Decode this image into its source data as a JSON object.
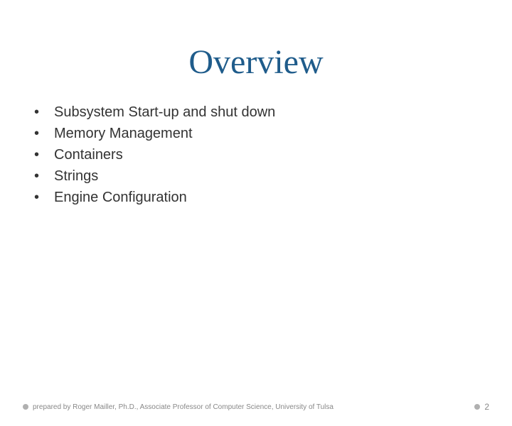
{
  "title": "Overview",
  "bullets": [
    "Subsystem Start-up and shut down",
    "Memory Management",
    "Containers",
    "Strings",
    "Engine Configuration"
  ],
  "footer": {
    "credit": "prepared by Roger Mailler, Ph.D., Associate Professor of Computer Science, University of Tulsa",
    "page": "2"
  }
}
